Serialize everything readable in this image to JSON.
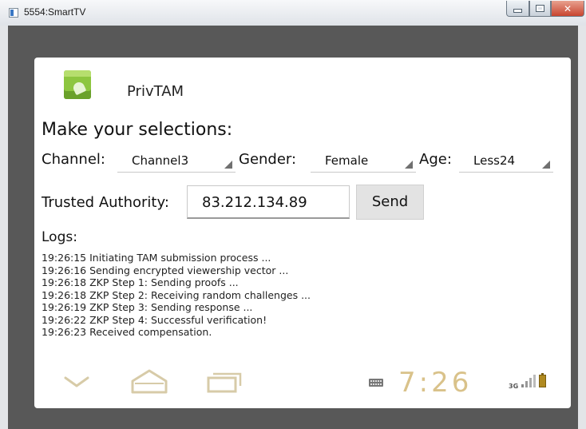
{
  "window": {
    "title": "5554:SmartTV"
  },
  "app": {
    "name": "PrivTAM",
    "heading": "Make your selections:"
  },
  "selections": {
    "channel_label": "Channel:",
    "channel_value": "Channel3",
    "gender_label": "Gender:",
    "gender_value": "Female",
    "age_label": "Age:",
    "age_value": "Less24"
  },
  "authority": {
    "label": "Trusted Authority:",
    "value": "83.212.134.89",
    "send_label": "Send"
  },
  "logs": {
    "label": "Logs:",
    "lines": [
      "19:26:15 Initiating TAM submission process ...",
      "19:26:16 Sending encrypted viewership vector ...",
      "19:26:18 ZKP Step 1: Sending proofs ...",
      "19:26:18 ZKP Step 2: Receiving random challenges ...",
      "19:26:19 ZKP Step 3: Sending response ...",
      "19:26:22 ZKP Step 4: Successful verification!",
      "19:26:23 Received compensation."
    ]
  },
  "status": {
    "time": "7:26",
    "network": "3G"
  },
  "colors": {
    "clock": "#d9c28a",
    "nav_icons": "#d7cba8"
  },
  "icons": [
    "app-icon",
    "back-icon",
    "home-icon",
    "recent-apps-icon",
    "keyboard-icon",
    "signal-icon",
    "battery-icon"
  ]
}
